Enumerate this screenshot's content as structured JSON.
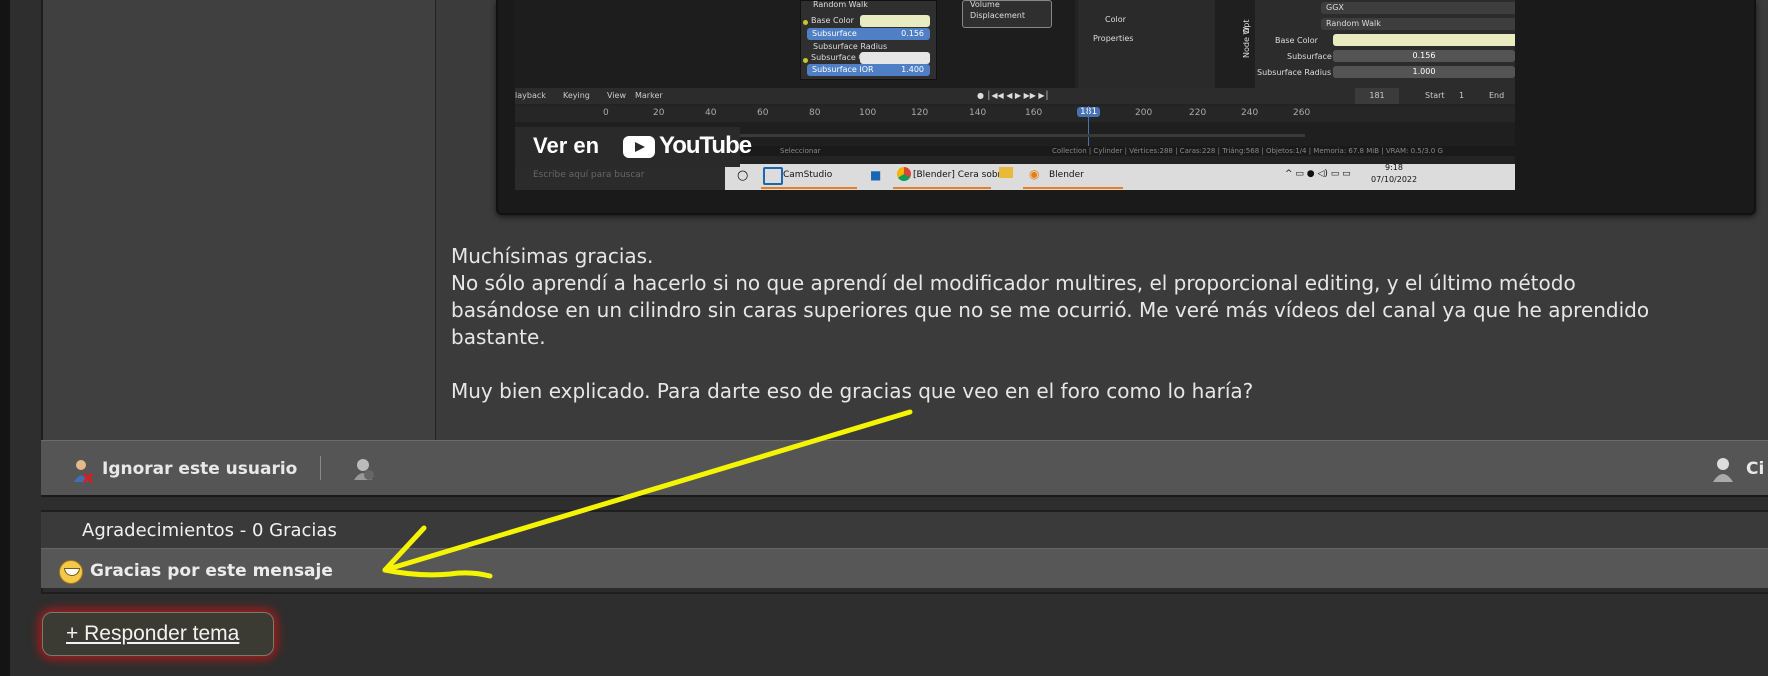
{
  "video": {
    "overlay_ver_en": "Ver en",
    "overlay_youtube": "YouTube",
    "blender": {
      "node_labels": [
        "Random Walk",
        "Base Color",
        "Subsurface",
        "Subsurface Radius",
        "Subsurface Colo",
        "Subsurface IOR",
        "Volume",
        "Displacement"
      ],
      "node_values": {
        "subsurface": "0.156",
        "subsurface_ior": "1.400"
      },
      "panel": {
        "color": "Color",
        "properties": "Properties",
        "ggx": "GGX",
        "random_walk": "Random Walk",
        "base_color": "Base Color",
        "subsurface": "Subsurface",
        "subsurface_val": "0.156",
        "subsurface_radius": "Subsurface Radius",
        "radius_val": "1.000"
      },
      "side_tabs": [
        "Opt",
        "Node W"
      ],
      "timeline_menu": [
        "layback",
        "Keying",
        "View",
        "Marker"
      ],
      "frame_current": "181",
      "start_label": "Start",
      "start_value": "1",
      "end_label": "End",
      "frame_numbers": [
        "0",
        "20",
        "40",
        "60",
        "80",
        "100",
        "120",
        "140",
        "160",
        "181",
        "200",
        "220",
        "240",
        "260"
      ],
      "status_left": "Seleccionar",
      "status_right": "Collection | Cylinder | Vértices:288 | Caras:228 | Triáng:568 | Objetos:1/4 | Memoria: 67.8 MiB | VRAM: 0.5/3.0 G"
    },
    "taskbar": {
      "search_placeholder": "Escribe aquí para buscar",
      "apps": [
        "CamStudio",
        "[Blender] Cera sobr...",
        "Blender"
      ],
      "time": "9:18",
      "date": "07/10/2022"
    }
  },
  "post": {
    "lines": [
      "Muchísimas gracias.",
      "No sólo aprendí a hacerlo si no que aprendí del modificador multires, el proporcional editing, y el último método",
      "basándose en un cilindro sin caras superiores que no se me ocurrió. Me veré más vídeos del canal ya que he aprendido",
      "bastante.",
      "Muy bien explicado. Para darte eso de gracias que veo en el foro como lo haría?"
    ],
    "footer": {
      "ignore_label": "Ignorar este usuario",
      "cite_label": "Ci"
    }
  },
  "thanks": {
    "title": "Agradecimientos - 0 Gracias",
    "button_label": "Gracias por este mensaje"
  },
  "reply_button": "+ Responder tema",
  "annotation": {
    "arrow_color": "#f5f500"
  }
}
